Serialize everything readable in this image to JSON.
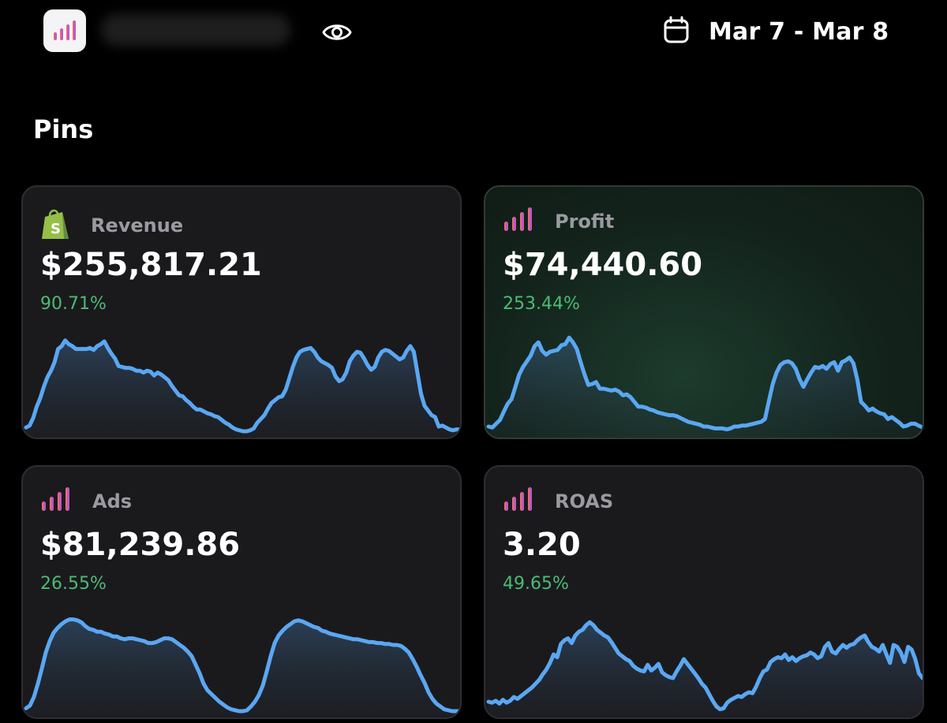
{
  "header": {
    "date_range": "Mar 7 - Mar 8"
  },
  "section_title": "Pins",
  "colors": {
    "accent_line": "#5aa7f2",
    "positive_change": "#4dbb73",
    "shopify_green": "#95bf47"
  },
  "cards": [
    {
      "label": "Revenue",
      "icon": "shopify-icon",
      "value": "$255,817.21",
      "change": "90.71%",
      "sparkline": [
        4,
        6,
        14,
        26,
        35,
        47,
        57,
        64,
        73,
        87,
        90,
        96,
        92,
        90,
        87,
        87,
        87,
        87,
        88,
        86,
        90,
        92,
        95,
        88,
        82,
        77,
        69,
        68,
        67,
        67,
        66,
        64,
        64,
        62,
        64,
        63,
        59,
        62,
        60,
        57,
        54,
        48,
        43,
        38,
        37,
        33,
        30,
        26,
        23,
        23,
        21,
        19,
        18,
        16,
        15,
        12,
        9,
        7,
        4,
        2,
        1,
        0,
        0,
        1,
        3,
        9,
        13,
        17,
        24,
        30,
        33,
        36,
        37,
        44,
        56,
        68,
        78,
        84,
        86,
        87,
        88,
        84,
        78,
        74,
        72,
        70,
        67,
        58,
        53,
        55,
        62,
        74,
        80,
        84,
        83,
        77,
        70,
        65,
        68,
        78,
        84,
        86,
        85,
        82,
        79,
        76,
        78,
        85,
        90,
        84,
        62,
        40,
        27,
        22,
        17,
        15,
        5,
        6,
        4,
        2,
        1,
        2,
        2
      ]
    },
    {
      "label": "Profit",
      "icon": "bars-icon",
      "value": "$74,440.60",
      "change": "253.44%",
      "sparkline": [
        5,
        4,
        8,
        12,
        21,
        29,
        34,
        47,
        60,
        68,
        74,
        80,
        90,
        94,
        85,
        81,
        84,
        85,
        86,
        91,
        92,
        99,
        94,
        87,
        73,
        60,
        49,
        50,
        52,
        45,
        45,
        44,
        43,
        44,
        42,
        38,
        39,
        36,
        31,
        26,
        26,
        25,
        23,
        22,
        20,
        19,
        18,
        17,
        17,
        16,
        14,
        12,
        10,
        9,
        8,
        7,
        5,
        5,
        4,
        3,
        3,
        3,
        2,
        3,
        5,
        5,
        6,
        6,
        7,
        8,
        9,
        10,
        13,
        32,
        50,
        62,
        70,
        73,
        74,
        72,
        66,
        55,
        47,
        55,
        62,
        68,
        67,
        69,
        66,
        71,
        73,
        64,
        73,
        75,
        78,
        72,
        55,
        31,
        27,
        22,
        24,
        21,
        19,
        18,
        13,
        15,
        12,
        9,
        5,
        6,
        8,
        8,
        6,
        4
      ]
    },
    {
      "label": "Ads",
      "icon": "bars-icon",
      "value": "$81,239.86",
      "change": "26.55%",
      "sparkline": [
        3,
        6,
        15,
        29,
        45,
        62,
        74,
        83,
        88,
        92,
        95,
        97,
        97,
        96,
        94,
        90,
        87,
        86,
        84,
        84,
        82,
        81,
        79,
        79,
        77,
        76,
        77,
        77,
        76,
        75,
        74,
        72,
        72,
        73,
        75,
        77,
        77,
        76,
        73,
        70,
        67,
        63,
        58,
        49,
        40,
        29,
        22,
        18,
        14,
        10,
        7,
        4,
        2,
        1,
        0,
        0,
        1,
        5,
        10,
        17,
        27,
        42,
        58,
        72,
        80,
        85,
        89,
        92,
        95,
        96,
        95,
        93,
        91,
        89,
        88,
        85,
        84,
        82,
        81,
        80,
        79,
        78,
        77,
        76,
        76,
        75,
        74,
        73,
        73,
        72,
        72,
        71,
        71,
        70,
        70,
        69,
        66,
        62,
        55,
        47,
        38,
        30,
        20,
        13,
        8,
        5,
        2,
        1,
        0,
        0,
        0
      ]
    },
    {
      "label": "ROAS",
      "icon": "bars-icon",
      "value": "3.20",
      "change": "49.65%",
      "sparkline": [
        10,
        9,
        11,
        8,
        12,
        9,
        11,
        15,
        13,
        16,
        19,
        22,
        25,
        29,
        33,
        39,
        44,
        51,
        60,
        57,
        71,
        75,
        77,
        72,
        80,
        84,
        86,
        91,
        94,
        91,
        86,
        83,
        80,
        78,
        73,
        67,
        61,
        58,
        55,
        53,
        48,
        45,
        43,
        42,
        49,
        43,
        46,
        50,
        41,
        38,
        36,
        35,
        42,
        48,
        55,
        50,
        45,
        40,
        35,
        29,
        25,
        18,
        11,
        5,
        2,
        3,
        9,
        12,
        14,
        16,
        15,
        18,
        20,
        19,
        26,
        35,
        42,
        44,
        52,
        55,
        57,
        56,
        60,
        54,
        57,
        53,
        56,
        58,
        59,
        62,
        60,
        56,
        58,
        68,
        72,
        63,
        61,
        66,
        70,
        67,
        70,
        71,
        75,
        78,
        80,
        73,
        68,
        66,
        63,
        70,
        60,
        51,
        70,
        68,
        62,
        52,
        68,
        65,
        55,
        40,
        35
      ]
    }
  ]
}
